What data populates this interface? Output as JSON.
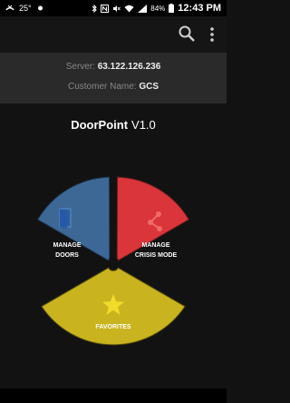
{
  "status_bar": {
    "temperature": "25°",
    "battery": "84%",
    "time": "12:43 PM"
  },
  "action_bar": {
    "icons": [
      "search-icon",
      "overflow-menu-icon"
    ]
  },
  "server_info": {
    "server_label": "Server:",
    "server_value": "63.122.126.236",
    "customer_label": "Customer Name:",
    "customer_value": "GCS"
  },
  "app": {
    "name": "DoorPoint",
    "version": "V1.0"
  },
  "menu": {
    "manage_doors": {
      "line1": "MANAGE",
      "line2": "DOORS",
      "color": "#3d6896",
      "icon": "door-icon"
    },
    "manage_crisis": {
      "line1": "MANAGE",
      "line2": "CRISIS MODE",
      "color": "#d9353a",
      "icon": "share-icon"
    },
    "favorites": {
      "label": "FAVORITES",
      "color": "#c9b41f",
      "icon": "star-icon"
    }
  },
  "colors": {
    "background": "#121212",
    "info_panel": "#2a2a2a"
  }
}
